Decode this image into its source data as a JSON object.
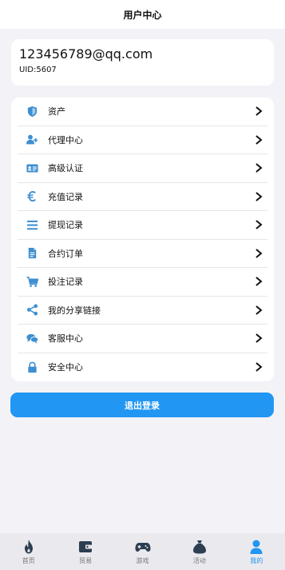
{
  "header": {
    "title": "用户中心"
  },
  "user": {
    "email": "123456789@qq.com",
    "uid": "UID:5607"
  },
  "menu": [
    {
      "label": "资产",
      "icon": "shield-icon"
    },
    {
      "label": "代理中心",
      "icon": "user-add-icon"
    },
    {
      "label": "高级认证",
      "icon": "id-card-icon"
    },
    {
      "label": "充值记录",
      "icon": "euro-icon"
    },
    {
      "label": "提现记录",
      "icon": "list-icon"
    },
    {
      "label": "合约订单",
      "icon": "document-icon"
    },
    {
      "label": "投注记录",
      "icon": "cart-icon"
    },
    {
      "label": "我的分享链接",
      "icon": "share-icon"
    },
    {
      "label": "客服中心",
      "icon": "chat-icon"
    },
    {
      "label": "安全中心",
      "icon": "lock-icon"
    }
  ],
  "logout_label": "退出登录",
  "tabs": [
    {
      "label": "首页",
      "icon": "flame-icon"
    },
    {
      "label": "贸易",
      "icon": "wallet-icon"
    },
    {
      "label": "游戏",
      "icon": "gamepad-icon"
    },
    {
      "label": "活动",
      "icon": "money-bag-icon"
    },
    {
      "label": "我的",
      "icon": "person-icon",
      "active": true
    }
  ],
  "colors": {
    "accent": "#2196f3",
    "icon": "#3d8fd1",
    "tab_icon": "#2c3e50"
  }
}
